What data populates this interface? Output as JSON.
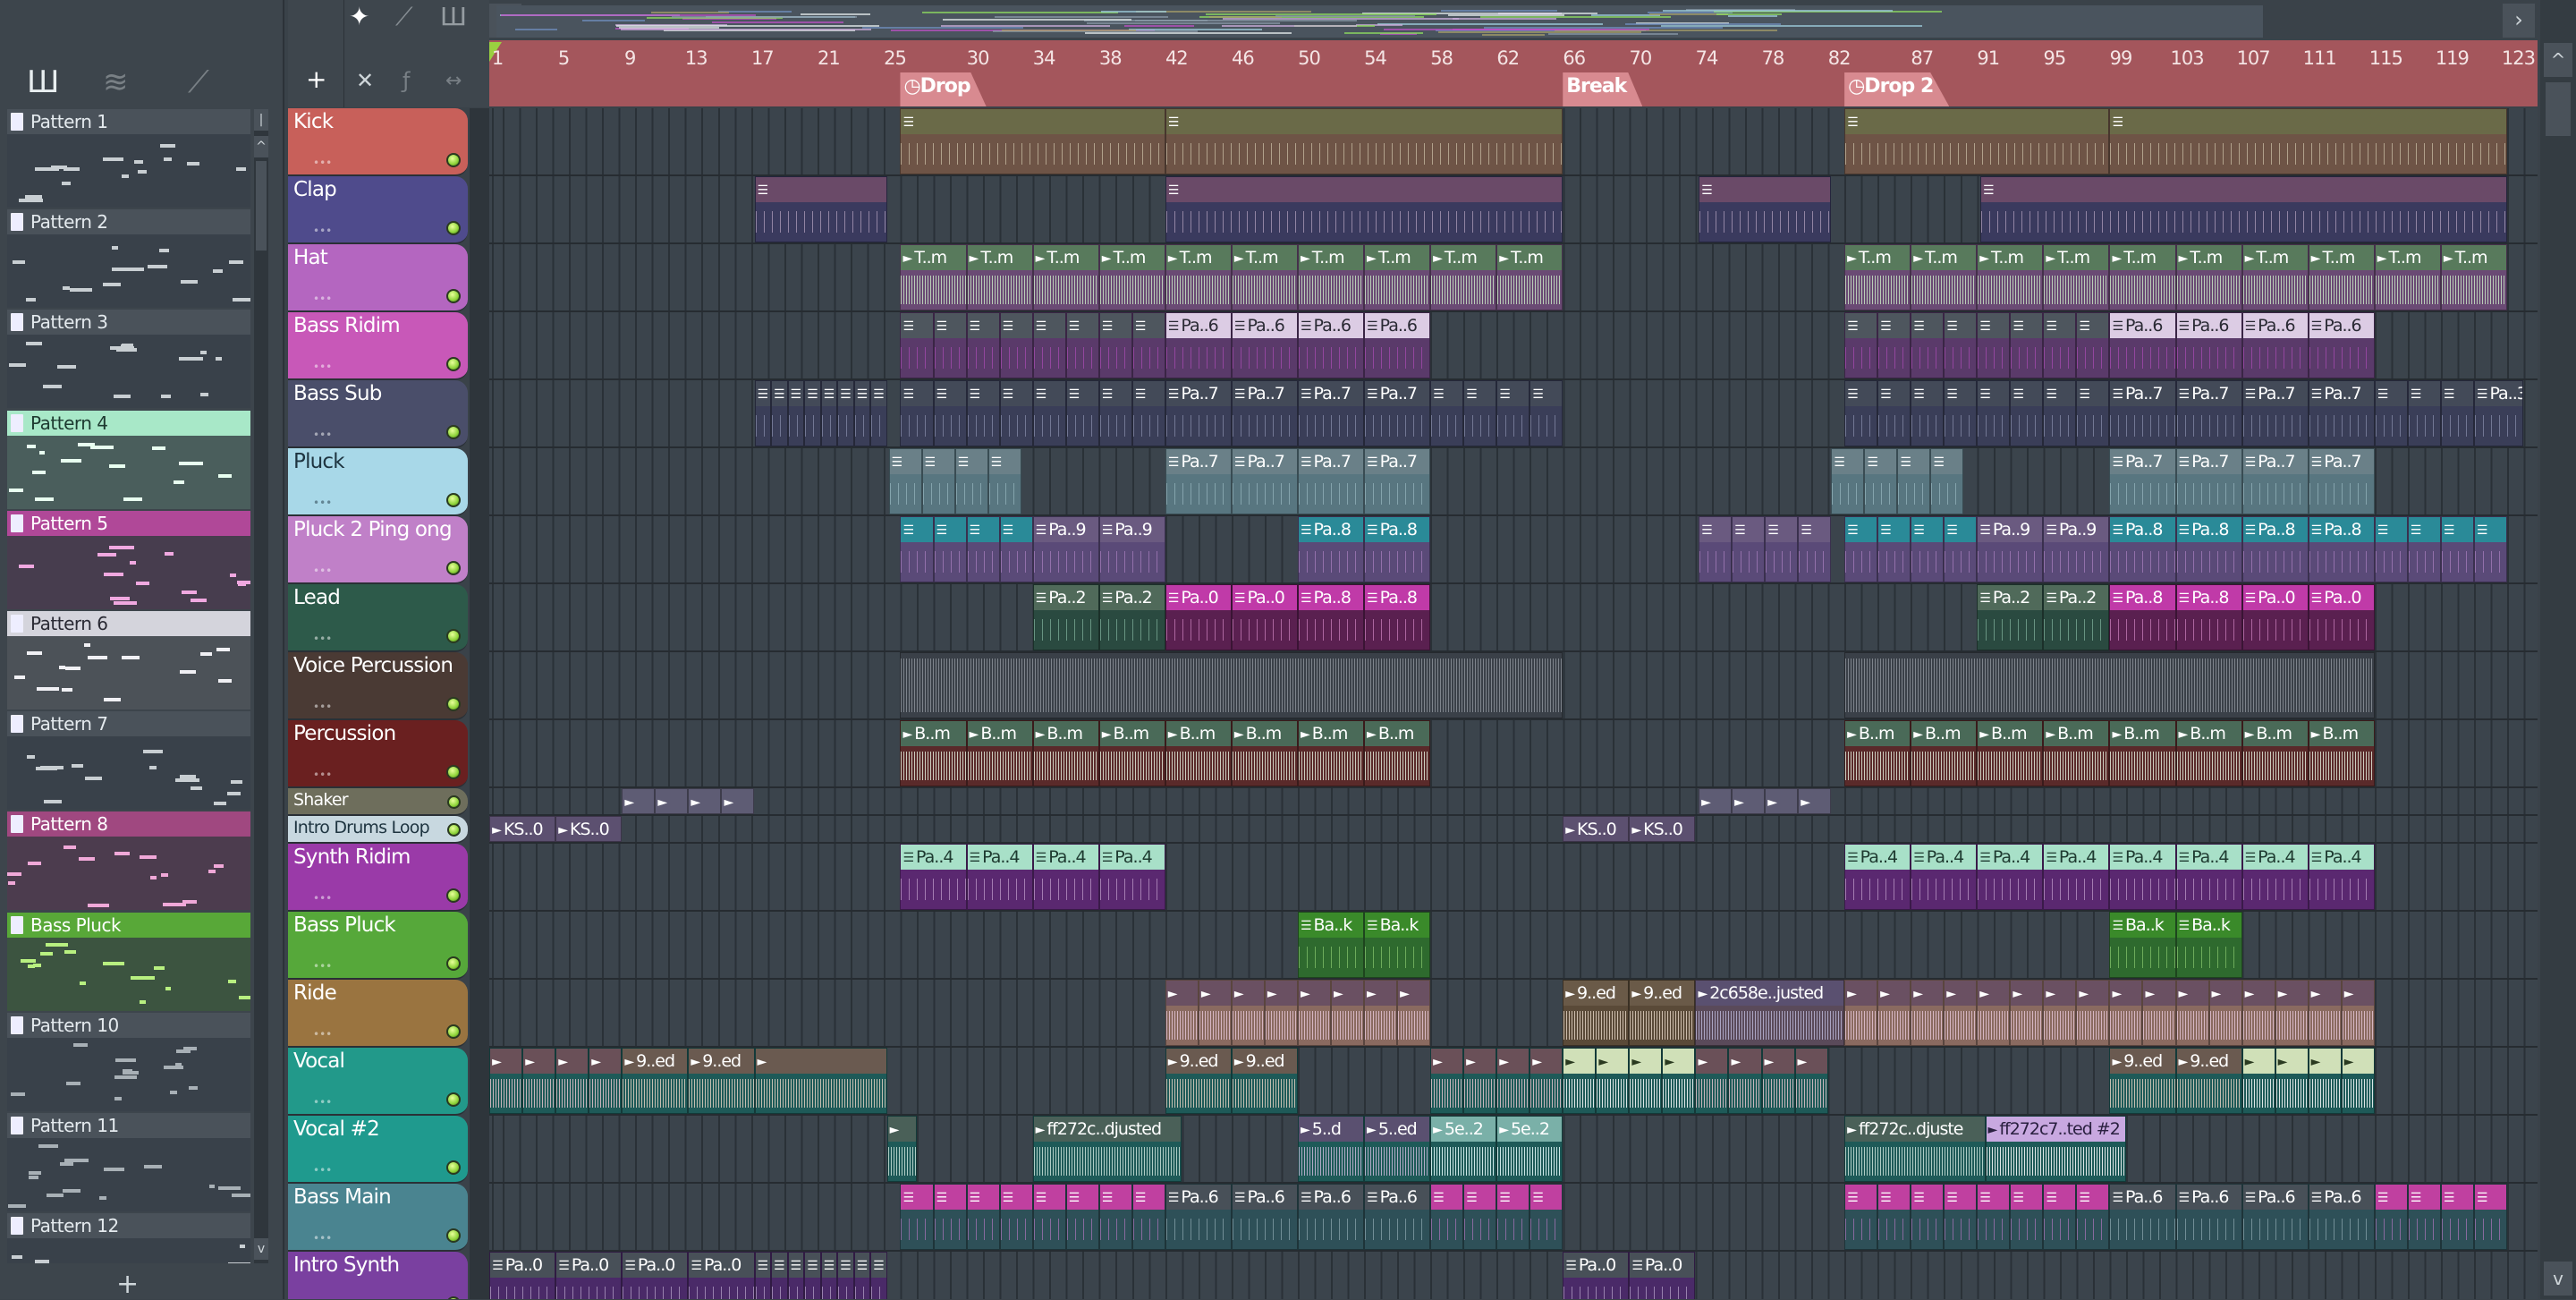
{
  "left_panel": {
    "tool_icons": [
      "piano-roll-icon",
      "waveform-icon",
      "automation-icon"
    ],
    "add_label": "+",
    "patterns": [
      {
        "name": "Pattern 1",
        "head": "#4a525a",
        "note": "#c8ced2",
        "text": "#e4eaee"
      },
      {
        "name": "Pattern 2",
        "head": "#4a525a",
        "note": "#c8ced2",
        "text": "#e4eaee"
      },
      {
        "name": "Pattern 3",
        "head": "#4a525a",
        "note": "#c8ced2",
        "text": "#e4eaee"
      },
      {
        "name": "Pattern 4",
        "head": "#a8e8c8",
        "note": "#e8fff0",
        "text": "#1e3a30",
        "bg": "#4a5e5c"
      },
      {
        "name": "Pattern 5",
        "head": "#b04898",
        "note": "#f0a8e0",
        "text": "#ffffff",
        "bg": "#473d4e"
      },
      {
        "name": "Pattern 6",
        "head": "#d4d4dc",
        "note": "#f0f0f4",
        "text": "#2a2a34",
        "bg": "#4c5258"
      },
      {
        "name": "Pattern 7",
        "head": "#4a525a",
        "note": "#c8ced2",
        "text": "#e4eaee"
      },
      {
        "name": "Pattern 8",
        "head": "#a04880",
        "note": "#f0a8d8",
        "text": "#ffffff",
        "bg": "#4c3c4e"
      },
      {
        "name": "Bass Pluck",
        "head": "#58a838",
        "note": "#b8f080",
        "text": "#ffffff",
        "bg": "#3c5440"
      },
      {
        "name": "Pattern 10",
        "head": "#4a525a",
        "note": "#a8b0b6",
        "text": "#e4eaee"
      },
      {
        "name": "Pattern 11",
        "head": "#4a525a",
        "note": "#a8b0b6",
        "text": "#e4eaee"
      },
      {
        "name": "Pattern 12",
        "head": "#4a525a",
        "note": "#c8ced2",
        "text": "#e4eaee"
      }
    ]
  },
  "toolbar": {
    "add_track": "+",
    "icons": [
      "waveform-icon",
      "automation-icon",
      "piano-roll-icon",
      "delete-icon",
      "slice-icon",
      "stretch-icon"
    ]
  },
  "ruler": {
    "labels": [
      1,
      5,
      9,
      13,
      17,
      21,
      25,
      30,
      34,
      38,
      42,
      46,
      50,
      54,
      58,
      62,
      66,
      70,
      74,
      78,
      82,
      87,
      91,
      95,
      99,
      103,
      107,
      111,
      115,
      119,
      123
    ],
    "markers": [
      {
        "label": "Drop",
        "bar": 25,
        "clock": true
      },
      {
        "label": "Break",
        "bar": 65,
        "clock": false
      },
      {
        "label": "Drop 2",
        "bar": 82,
        "clock": true
      }
    ]
  },
  "styles": {
    "kick": {
      "head": "#6a6a48",
      "body": "#6e5446",
      "wave": "#e8e0c4",
      "text": "#fff"
    },
    "clap": {
      "head": "#6a4a68",
      "body": "#3a3a5e",
      "wave": "#d8c0dc",
      "text": "#fff"
    },
    "hat": {
      "head": "#587a5c",
      "body": "#6a4a74",
      "wave": "#c8e4c4",
      "text": "#fff"
    },
    "ridim": {
      "head": "#4e565e",
      "body": "#5a3a6a",
      "wave": "#c050c8",
      "text": "#fff"
    },
    "ridim_alt": {
      "head": "#dcccE4",
      "body": "#5a3a6a",
      "wave": "#c050c8",
      "text": "#2a2a34"
    },
    "sub": {
      "head": "#434a58",
      "body": "#3a3e58",
      "wave": "#a0a6c4",
      "text": "#fff"
    },
    "pluck": {
      "head": "#6a8088",
      "body": "#587680",
      "wave": "#a8c8d0",
      "text": "#fff"
    },
    "pluck2": {
      "head": "#2a8a98",
      "body": "#5a4a78",
      "wave": "#c090d4",
      "text": "#fff"
    },
    "pluck2_alt": {
      "head": "#6a5a80",
      "body": "#5a4a78",
      "wave": "#c090d4",
      "text": "#fff"
    },
    "lead": {
      "head": "#506a5a",
      "body": "#2a4a40",
      "wave": "#9ad0b8",
      "text": "#fff"
    },
    "lead_alt": {
      "head": "#c03aa8",
      "body": "#5a2050",
      "wave": "#f0a0e0",
      "text": "#fff"
    },
    "voice": {
      "head": "#3a4048",
      "body": "#3a4048",
      "wave": "#8a9098",
      "text": "#fff"
    },
    "perc": {
      "head": "#4a6a58",
      "body": "#5a2a2a",
      "wave": "#e0e8d8",
      "text": "#fff"
    },
    "shaker": {
      "head": "#5e5c74",
      "body": "#5e5c74",
      "wave": "#9a98b0",
      "text": "#fff"
    },
    "introdrums": {
      "head": "#5c5070",
      "body": "#5c5070",
      "wave": "#9a90b0",
      "text": "#fff"
    },
    "synth": {
      "head": "#a8e0c8",
      "body": "#5a2870",
      "wave": "#e0c0e8",
      "text": "#1e3a30"
    },
    "bpluck": {
      "head": "#3a8a2a",
      "body": "#2e6a2e",
      "wave": "#a0e080",
      "text": "#fff"
    },
    "ride": {
      "head": "#6a5062",
      "body": "#8a6a60",
      "wave": "#e4c4d4",
      "text": "#fff"
    },
    "ride_alt": {
      "head": "#6a5a48",
      "body": "#5a4a38",
      "wave": "#e0d0c0",
      "text": "#fff"
    },
    "ride_alt2": {
      "head": "#5a5070",
      "body": "#5a4a5a",
      "wave": "#b8b4d4",
      "text": "#fff"
    },
    "vocal": {
      "head": "#6a5058",
      "body": "#1e5a58",
      "wave": "#e4c4cc",
      "text": "#fff"
    },
    "vocal_alt": {
      "head": "#6a5a50",
      "body": "#1e5a58",
      "wave": "#e0d0c0",
      "text": "#fff"
    },
    "vocal_alt2": {
      "head": "#d0e0b8",
      "body": "#1e5a58",
      "wave": "#ffffff",
      "text": "#2a3a20"
    },
    "vocal2": {
      "head": "#4a6058",
      "body": "#1e5a58",
      "wave": "#c8e0d8",
      "text": "#fff"
    },
    "vocal2_alt": {
      "head": "#5a5070",
      "body": "#1e5a58",
      "wave": "#c8b8d8",
      "text": "#fff"
    },
    "vocal2_alt2": {
      "head": "#7ab0a8",
      "body": "#1e5a58",
      "wave": "#e8ffff",
      "text": "#fff"
    },
    "vocal2_alt3": {
      "head": "#c8a8e0",
      "body": "#1e5a58",
      "wave": "#ffffff",
      "text": "#2a2040"
    },
    "bmain": {
      "head": "#c040a0",
      "body": "#2e5058",
      "wave": "#d080d8",
      "text": "#fff"
    },
    "bmain_alt": {
      "head": "#485058",
      "body": "#2e5058",
      "wave": "#a8c0c8",
      "text": "#fff"
    },
    "isynth": {
      "head": "#485058",
      "body": "#4a2a68",
      "wave": "#d8c8e8",
      "text": "#fff"
    }
  },
  "tracks": [
    {
      "name": "Kick",
      "color": "#c8605a",
      "text": "#fff",
      "small": false,
      "style": "kick",
      "noheader": false,
      "clips": [
        [
          25,
          41,
          ""
        ],
        [
          41,
          65,
          ""
        ],
        [
          82,
          98,
          ""
        ],
        [
          98,
          122,
          ""
        ]
      ]
    },
    {
      "name": "Clap",
      "color": "#4f4b8c",
      "text": "#fff",
      "small": false,
      "style": "clap",
      "clips": [
        [
          16.2,
          24.2,
          ""
        ],
        [
          41,
          65,
          ""
        ],
        [
          73.2,
          81.2,
          ""
        ],
        [
          90.2,
          122,
          ""
        ]
      ]
    },
    {
      "name": "Hat",
      "color": "#b466c0",
      "text": "#fff",
      "small": false,
      "style": "hat",
      "audio": true,
      "seqs": [
        {
          "from": 25,
          "to": 65,
          "step": 4,
          "label": "T..m"
        },
        {
          "from": 82,
          "to": 122,
          "step": 4,
          "label": "T..m"
        }
      ]
    },
    {
      "name": "Bass Ridim",
      "color": "#c858b8",
      "text": "#fff",
      "small": false,
      "style": "ridim",
      "seqs": [
        {
          "from": 25,
          "to": 41,
          "step": 2,
          "label": ""
        },
        {
          "from": 41,
          "to": 57,
          "step": 4,
          "label": "Pa..6",
          "style": "ridim_alt"
        },
        {
          "from": 82,
          "to": 98,
          "step": 2,
          "label": ""
        },
        {
          "from": 98,
          "to": 114,
          "step": 4,
          "label": "Pa..6",
          "style": "ridim_alt"
        }
      ]
    },
    {
      "name": "Bass Sub",
      "color": "#4a4e6a",
      "text": "#fff",
      "small": false,
      "style": "sub",
      "seqs": [
        {
          "from": 16.2,
          "to": 24.2,
          "step": 1,
          "label": ""
        },
        {
          "from": 25,
          "to": 41,
          "step": 2,
          "label": ""
        },
        {
          "from": 41,
          "to": 57,
          "step": 4,
          "label": "Pa..7"
        },
        {
          "from": 57,
          "to": 65,
          "step": 2,
          "label": ""
        },
        {
          "from": 82,
          "to": 98,
          "step": 2,
          "label": ""
        },
        {
          "from": 98,
          "to": 114,
          "step": 4,
          "label": "Pa..7"
        },
        {
          "from": 114,
          "to": 120,
          "step": 2,
          "label": ""
        },
        {
          "from": 120,
          "to": 123,
          "step": 3,
          "label": "Pa..3"
        }
      ]
    },
    {
      "name": "Pluck",
      "color": "#a8d8e8",
      "text": "#1e3440",
      "small": false,
      "style": "pluck",
      "seqs": [
        {
          "from": 24.3,
          "to": 32.3,
          "step": 2,
          "label": ""
        },
        {
          "from": 41,
          "to": 57,
          "step": 4,
          "label": "Pa..7"
        },
        {
          "from": 81.2,
          "to": 89.2,
          "step": 2,
          "label": ""
        },
        {
          "from": 98,
          "to": 114,
          "step": 4,
          "label": "Pa..7"
        }
      ]
    },
    {
      "name": "Pluck 2 Ping ong",
      "color": "#c080c8",
      "text": "#fff",
      "small": false,
      "style": "pluck2",
      "seqs": [
        {
          "from": 25,
          "to": 33,
          "step": 2,
          "label": ""
        },
        {
          "from": 33,
          "to": 41,
          "step": 4,
          "label": "Pa..9",
          "style": "pluck2_alt"
        },
        {
          "from": 49,
          "to": 57,
          "step": 4,
          "label": "Pa..8"
        },
        {
          "from": 73.2,
          "to": 81.2,
          "step": 2,
          "label": "",
          "style": "pluck2_alt"
        },
        {
          "from": 82,
          "to": 90,
          "step": 2,
          "label": ""
        },
        {
          "from": 90,
          "to": 98,
          "step": 4,
          "label": "Pa..9",
          "style": "pluck2_alt"
        },
        {
          "from": 98,
          "to": 114,
          "step": 4,
          "label": "Pa..8"
        },
        {
          "from": 114,
          "to": 122,
          "step": 2,
          "label": ""
        }
      ]
    },
    {
      "name": "Lead",
      "color": "#2d5a4a",
      "text": "#fff",
      "small": false,
      "style": "lead",
      "seqs": [
        {
          "from": 33,
          "to": 41,
          "step": 4,
          "label": "Pa..2"
        },
        {
          "from": 41,
          "to": 49,
          "step": 4,
          "label": "Pa..0",
          "style": "lead_alt"
        },
        {
          "from": 49,
          "to": 57,
          "step": 4,
          "label": "Pa..8",
          "style": "lead_alt"
        },
        {
          "from": 90,
          "to": 98,
          "step": 4,
          "label": "Pa..2"
        },
        {
          "from": 98,
          "to": 106,
          "step": 4,
          "label": "Pa..8",
          "style": "lead_alt"
        },
        {
          "from": 106,
          "to": 114,
          "step": 4,
          "label": "Pa..0",
          "style": "lead_alt"
        }
      ]
    },
    {
      "name": "Voice Percussion",
      "color": "#4a3a34",
      "text": "#fff",
      "small": false,
      "style": "voice",
      "audio": true,
      "nohead": true,
      "clips": [
        [
          25,
          65,
          ""
        ],
        [
          82,
          114,
          ""
        ]
      ]
    },
    {
      "name": "Percussion",
      "color": "#6a2020",
      "text": "#fff",
      "small": false,
      "style": "perc",
      "audio": true,
      "seqs": [
        {
          "from": 25,
          "to": 57,
          "step": 4,
          "label": "B..m"
        },
        {
          "from": 82,
          "to": 114,
          "step": 4,
          "label": "B..m"
        }
      ]
    },
    {
      "name": "Shaker",
      "color": "#6e6e5c",
      "text": "#fff",
      "small": true,
      "style": "shaker",
      "audio": true,
      "seqs": [
        {
          "from": 8.2,
          "to": 16.2,
          "step": 2,
          "label": ""
        },
        {
          "from": 73.2,
          "to": 81.2,
          "step": 2,
          "label": ""
        }
      ]
    },
    {
      "name": "Intro Drums Loop",
      "color": "#c8d8e0",
      "text": "#1e3440",
      "small": true,
      "style": "introdrums",
      "audio": true,
      "seqs": [
        {
          "from": 0.2,
          "to": 8.2,
          "step": 4,
          "label": "KS..0"
        },
        {
          "from": 65,
          "to": 73,
          "step": 4,
          "label": "KS..0"
        }
      ]
    },
    {
      "name": "Synth Ridim",
      "color": "#9a3aa8",
      "text": "#fff",
      "small": false,
      "style": "synth",
      "seqs": [
        {
          "from": 25,
          "to": 41,
          "step": 4,
          "label": "Pa..4"
        },
        {
          "from": 82,
          "to": 98,
          "step": 4,
          "label": "Pa..4"
        },
        {
          "from": 98,
          "to": 114,
          "step": 4,
          "label": "Pa..4"
        }
      ]
    },
    {
      "name": "Bass Pluck",
      "color": "#56a83a",
      "text": "#fff",
      "small": false,
      "style": "bpluck",
      "seqs": [
        {
          "from": 49,
          "to": 57,
          "step": 4,
          "label": "Ba..k"
        },
        {
          "from": 98,
          "to": 106,
          "step": 4,
          "label": "Ba..k"
        }
      ]
    },
    {
      "name": "Ride",
      "color": "#9a7440",
      "text": "#fff",
      "small": false,
      "style": "ride",
      "audio": true,
      "seqs": [
        {
          "from": 41,
          "to": 57,
          "step": 2,
          "label": ""
        },
        {
          "from": 65,
          "to": 73,
          "step": 4,
          "label": "9..ed",
          "style": "ride_alt"
        },
        {
          "from": 73,
          "to": 82,
          "step": 9,
          "label": "2c658e..justed",
          "style": "ride_alt2"
        },
        {
          "from": 82,
          "to": 98,
          "step": 2,
          "label": ""
        },
        {
          "from": 98,
          "to": 114,
          "step": 2,
          "label": ""
        }
      ]
    },
    {
      "name": "Vocal",
      "color": "#22998a",
      "text": "#fff",
      "small": false,
      "style": "vocal",
      "audio": true,
      "seqs": [
        {
          "from": 0.2,
          "to": 8.2,
          "step": 2,
          "label": ""
        },
        {
          "from": 8.2,
          "to": 16.2,
          "step": 4,
          "label": "9..ed",
          "style": "vocal_alt"
        },
        {
          "from": 16.2,
          "to": 24.2,
          "step": 8,
          "label": "",
          "style": "vocal_alt"
        },
        {
          "from": 41,
          "to": 49,
          "step": 4,
          "label": "9..ed",
          "style": "vocal_alt"
        },
        {
          "from": 57,
          "to": 65,
          "step": 2,
          "label": ""
        },
        {
          "from": 65,
          "to": 73,
          "step": 2,
          "label": "",
          "style": "vocal_alt2"
        },
        {
          "from": 73,
          "to": 81,
          "step": 2,
          "label": ""
        },
        {
          "from": 98,
          "to": 106,
          "step": 4,
          "label": "9..ed",
          "style": "vocal_alt"
        },
        {
          "from": 106,
          "to": 114,
          "step": 2,
          "label": "",
          "style": "vocal_alt2"
        }
      ]
    },
    {
      "name": "Vocal #2",
      "color": "#1f9a8e",
      "text": "#fff",
      "small": false,
      "style": "vocal2",
      "audio": true,
      "seqs": [
        {
          "from": 24.2,
          "to": 26,
          "step": 1.8,
          "label": ""
        },
        {
          "from": 33,
          "to": 42,
          "step": 9,
          "label": "ff272c..djusted"
        },
        {
          "from": 49,
          "to": 53,
          "step": 4,
          "label": "5..d",
          "style": "vocal2_alt"
        },
        {
          "from": 53,
          "to": 57,
          "step": 4,
          "label": "5..ed",
          "style": "vocal2_alt"
        },
        {
          "from": 57,
          "to": 65,
          "step": 4,
          "label": "5e..2",
          "style": "vocal2_alt2"
        },
        {
          "from": 82,
          "to": 90.5,
          "step": 8.5,
          "label": "ff272c..djuste"
        },
        {
          "from": 90.5,
          "to": 99,
          "step": 8.5,
          "label": "ff272c7..ted #2",
          "style": "vocal2_alt3"
        }
      ]
    },
    {
      "name": "Bass Main",
      "color": "#4a8490",
      "text": "#fff",
      "small": false,
      "style": "bmain",
      "seqs": [
        {
          "from": 25,
          "to": 41,
          "step": 2,
          "label": ""
        },
        {
          "from": 41,
          "to": 57,
          "step": 4,
          "label": "Pa..6",
          "style": "bmain_alt"
        },
        {
          "from": 57,
          "to": 65,
          "step": 2,
          "label": ""
        },
        {
          "from": 82,
          "to": 98,
          "step": 2,
          "label": ""
        },
        {
          "from": 98,
          "to": 114,
          "step": 4,
          "label": "Pa..6",
          "style": "bmain_alt"
        },
        {
          "from": 114,
          "to": 122,
          "step": 2,
          "label": ""
        }
      ]
    },
    {
      "name": "Intro Synth",
      "color": "#7a40a0",
      "text": "#fff",
      "small": false,
      "style": "isynth",
      "seqs": [
        {
          "from": 0.2,
          "to": 16.2,
          "step": 4,
          "label": "Pa..0"
        },
        {
          "from": 16.2,
          "to": 24.2,
          "step": 1,
          "label": ""
        },
        {
          "from": 65,
          "to": 73,
          "step": 4,
          "label": "Pa..0"
        }
      ]
    }
  ],
  "scroll": {
    "left": "‹",
    "right": "›",
    "up": "^",
    "down": "v"
  }
}
